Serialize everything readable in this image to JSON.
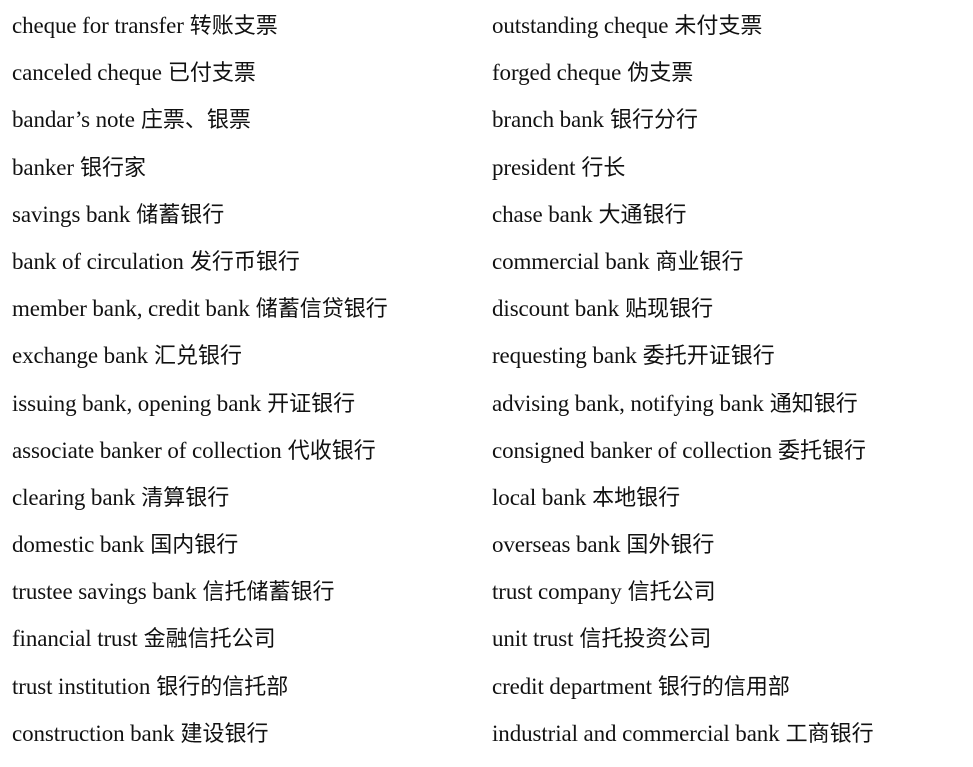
{
  "left_column": [
    {
      "en": "cheque for transfer",
      "zh": "转账支票"
    },
    {
      "en": "canceled cheque",
      "zh": "已付支票"
    },
    {
      "en": "bandar’s note",
      "zh": "庄票、银票"
    },
    {
      "en": "banker",
      "zh": "银行家"
    },
    {
      "en": "savings bank",
      "zh": "储蓄银行"
    },
    {
      "en": "bank of circulation",
      "zh": "发行币银行"
    },
    {
      "en": "member bank, credit bank",
      "zh": "储蓄信贷银行"
    },
    {
      "en": "exchange bank",
      "zh": "汇兑银行"
    },
    {
      "en": "issuing bank, opening bank",
      "zh": "开证银行"
    },
    {
      "en": "associate banker of collection",
      "zh": "代收银行"
    },
    {
      "en": "clearing bank",
      "zh": "清算银行"
    },
    {
      "en": "domestic bank",
      "zh": "国内银行"
    },
    {
      "en": "trustee savings bank",
      "zh": "信托储蓄银行"
    },
    {
      "en": "financial trust",
      "zh": "金融信托公司"
    },
    {
      "en": "trust institution",
      "zh": "银行的信托部"
    },
    {
      "en": "construction bank",
      "zh": "建设银行"
    }
  ],
  "right_column": [
    {
      "en": "outstanding cheque",
      "zh": "未付支票"
    },
    {
      "en": "forged cheque",
      "zh": "伪支票"
    },
    {
      "en": "branch bank",
      "zh": "银行分行"
    },
    {
      "en": "president",
      "zh": "行长"
    },
    {
      "en": "chase bank",
      "zh": "大通银行"
    },
    {
      "en": "commercial bank",
      "zh": "商业银行"
    },
    {
      "en": "discount bank",
      "zh": "贴现银行"
    },
    {
      "en": "requesting bank",
      "zh": "委托开证银行"
    },
    {
      "en": "advising bank, notifying bank",
      "zh": "通知银行"
    },
    {
      "en": "consigned banker of collection",
      "zh": "委托银行"
    },
    {
      "en": "local bank",
      "zh": "本地银行"
    },
    {
      "en": "overseas bank",
      "zh": "国外银行"
    },
    {
      "en": "trust company",
      "zh": "信托公司"
    },
    {
      "en": "unit trust",
      "zh": "信托投资公司"
    },
    {
      "en": "credit department",
      "zh": "银行的信用部"
    },
    {
      "en": "industrial and commercial bank",
      "zh": "工商银行"
    }
  ]
}
